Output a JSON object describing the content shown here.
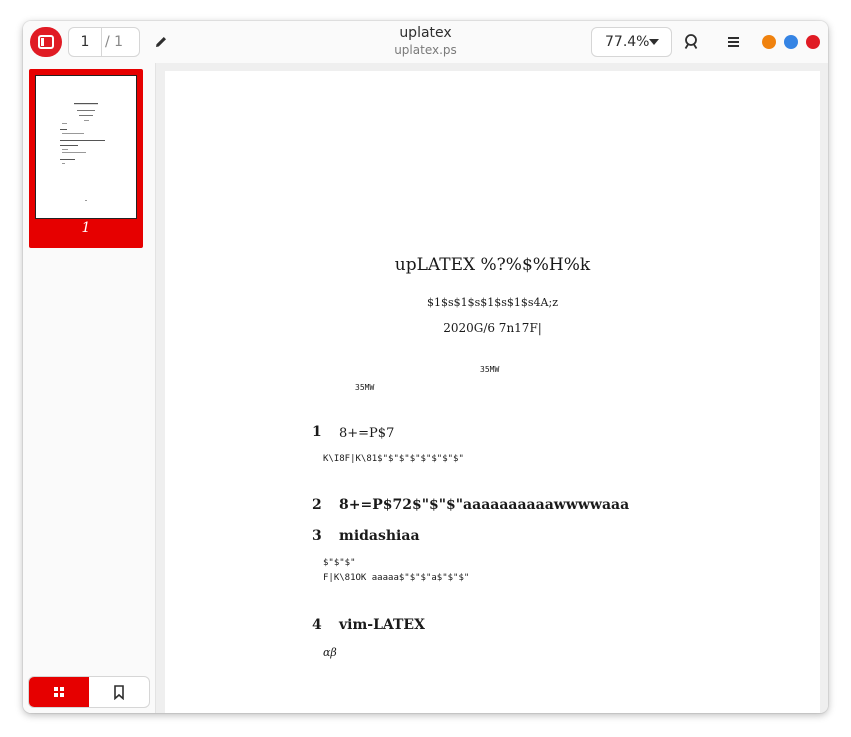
{
  "header": {
    "title": "uplatex",
    "subtitle": "uplatex.ps",
    "current_page": "1",
    "total_pages": "/ 1",
    "zoom": "77.4%",
    "icons": [
      "sidebar-toggle-icon",
      "pencil-icon",
      "search-icon",
      "hamburger-menu-icon"
    ],
    "window_controls": {
      "minimize": "#f0820e",
      "maximize": "#3584e4",
      "close": "#e01b24"
    }
  },
  "sidebar": {
    "thumbnail_label": "1",
    "tabs": [
      "grid-icon",
      "bookmark-icon"
    ],
    "accent": "#e60000"
  },
  "document": {
    "title": "upLATEX %?%$%H%k",
    "author": "$1$s$1$s$1$s$1$s4A;z",
    "date": "2020G/6 7n17F|",
    "small_line_1": "35MW",
    "small_line_2": "35MW",
    "sections": [
      {
        "number": "1",
        "title": "8+=P$7",
        "body": [
          "K\\I8F|K\\81$\"$\"$\"$\"$\"$\"$\"$\""
        ]
      },
      {
        "number": "2",
        "title": "8+=P$72$\"$\"$\"aaaaaaaaaawwwwaaa",
        "body": []
      },
      {
        "number": "3",
        "title": "midashiaa",
        "body": [
          "$\"$\"$\"",
          "F|K\\81OK aaaaa$\"$\"$\"a$\"$\"$\""
        ]
      },
      {
        "number": "4",
        "title": "vim-LATEX",
        "body": [
          "αβ"
        ]
      }
    ]
  }
}
